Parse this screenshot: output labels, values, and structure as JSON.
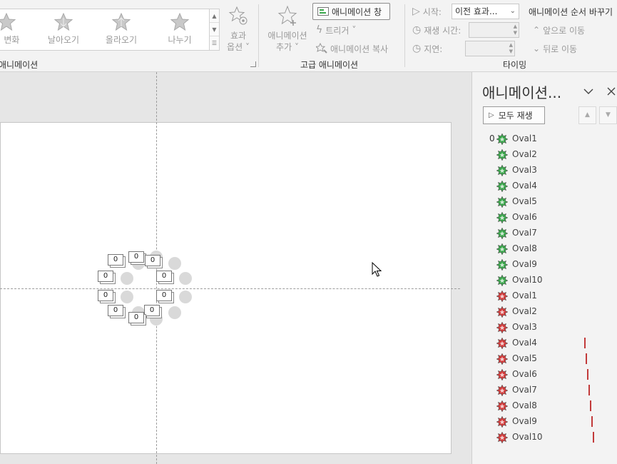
{
  "ribbon": {
    "gallery_items": [
      "변화",
      "날아오기",
      "올라오기",
      "나누기"
    ],
    "gallery_first_partial": "ㅣ",
    "effect_options": [
      "효과",
      "옵션"
    ],
    "group_animation": "애니메이션",
    "add_animation": [
      "애니메이션",
      "추가"
    ],
    "animation_pane_button": "애니메이션 창",
    "trigger": "트리거",
    "animation_painter": "애니메이션 복사",
    "group_advanced": "고급 애니메이션",
    "start_label": "시작:",
    "start_value": "이전 효과...",
    "duration_label": "재생 시간:",
    "delay_label": "지연:",
    "reorder_title": "애니메이션 순서 바꾸기",
    "move_earlier": "앞으로 이동",
    "move_later": "뒤로 이동",
    "group_timing": "타이밍"
  },
  "slide": {
    "tag_label": "0"
  },
  "pane": {
    "title": "애니메이션...",
    "play_all": "모두 재생",
    "first_index": "0",
    "entrance_items": [
      "Oval1",
      "Oval2",
      "Oval3",
      "Oval4",
      "Oval5",
      "Oval6",
      "Oval7",
      "Oval8",
      "Oval9",
      "Oval10"
    ],
    "exit_items": [
      "Oval1",
      "Oval2",
      "Oval3",
      "Oval4",
      "Oval5",
      "Oval6",
      "Oval7",
      "Oval8",
      "Oval9",
      "Oval10"
    ]
  },
  "colors": {
    "entrance": "#3aa64b",
    "exit": "#d23b3b",
    "timeline_bar": "#c23a3a"
  },
  "icons": {
    "entrance": "entrance-burst-icon",
    "exit": "exit-burst-icon"
  }
}
